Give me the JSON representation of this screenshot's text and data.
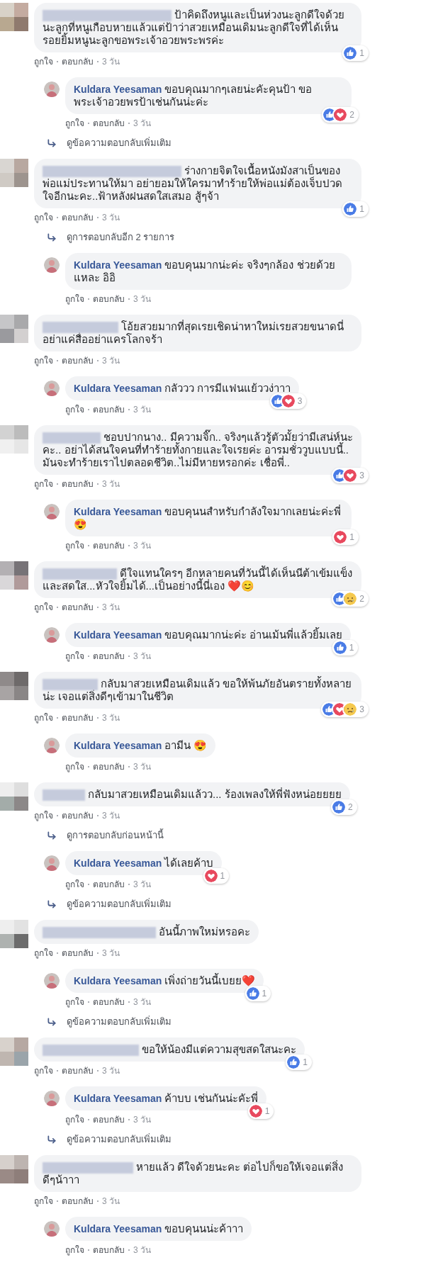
{
  "thread": [
    {
      "kind": "comment",
      "text": "ป้าคิดถึงหนูและเป็นห่วงนะลูกดีใจด้วยนะลูกที่หนูเกือบหายแล้วแต่ป้าว่าสวยเหมือนเดิมนะลูกดีใจที่ได้เห็นรอยยิ้มหนูนะลูกขอพระเจ้าอวยพระพรค่ะ",
      "reactions": [
        {
          "kind": "like"
        }
      ],
      "count": "1",
      "like": "ถูกใจ",
      "reply": "ตอบกลับ",
      "time": "3 วัน"
    },
    {
      "kind": "reply",
      "author": "Kuldara Yeesaman",
      "text": "ขอบคุณมากๆเลยน่ะคัะคุนป้า ขอพระเจ้าอวยพรป้าเช่นกันน่ะค่ะ",
      "reactions": [
        {
          "kind": "like"
        },
        {
          "kind": "love"
        }
      ],
      "count": "2",
      "like": "ถูกใจ",
      "reply": "ตอบกลับ",
      "time": "3 วัน"
    },
    {
      "kind": "more",
      "text": "ดูข้อความตอบกลับเพิ่มเติม"
    },
    {
      "kind": "comment",
      "text": "ร่างกายจิตใจเนื้อหนังมังสาเป็นของพ่อแม่ประทานให้มา อย่ายอมให้ใครมาทำร้ายให้พ่อแม่ต้องเจ็บปวดใจอีกนะคะ..ฟ้าหลังฝนสดใสเสมอ สู้ๆจ้า",
      "reactions": [
        {
          "kind": "like"
        }
      ],
      "count": "1",
      "like": "ถูกใจ",
      "reply": "ตอบกลับ",
      "time": "3 วัน"
    },
    {
      "kind": "more",
      "text": "ดูการตอบกลับอีก 2 รายการ"
    },
    {
      "kind": "reply",
      "author": "Kuldara Yeesaman",
      "text": "ขอบคุนมากน่ะค่ะ จริงๆกล้อง ช่วยด้วยแหละ อิอิ",
      "like": "ถูกใจ",
      "reply": "ตอบกลับ",
      "time": "3 วัน"
    },
    {
      "kind": "comment",
      "text": "โอ้ยสวยมากที่สุดเรยเชิดน่าหาใหม่เรยสวยขนาดนี่อย่าแค่สื่ออย่าแครโลกจร้า",
      "like": "ถูกใจ",
      "reply": "ตอบกลับ",
      "time": "3 วัน"
    },
    {
      "kind": "reply",
      "author": "Kuldara Yeesaman",
      "text": "กลัววว การมีแฟนแย้ววง่าาา",
      "reactions": [
        {
          "kind": "like"
        },
        {
          "kind": "love"
        }
      ],
      "count": "3",
      "like": "ถูกใจ",
      "reply": "ตอบกลับ",
      "time": "3 วัน"
    },
    {
      "kind": "comment",
      "text": "ชอบปากนาง.. มีความจิ๊ก.. จริงๆแล้วรู้ตัวมั้ยว่ามีเสน่ห์นะคะ.. อย่าได้สนใจคนที่ทำร้ายทั้งกายและใจเรยค่ะ อารมชั่ววูบแบบนี้.. มันจะทำร้ายเราไปตลอดชีวิต..ไม่มีหายหรอกค่ะ เชื่อพี่..",
      "reactions": [
        {
          "kind": "like"
        },
        {
          "kind": "love"
        }
      ],
      "count": "3",
      "like": "ถูกใจ",
      "reply": "ตอบกลับ",
      "time": "3 วัน"
    },
    {
      "kind": "reply",
      "author": "Kuldara Yeesaman",
      "text": "ขอบคุนนสำหรับกำลังใจมากเลยน่ะค่ะพี่ 😍",
      "reactions": [
        {
          "kind": "love"
        }
      ],
      "count": "1",
      "like": "ถูกใจ",
      "reply": "ตอบกลับ",
      "time": "3 วัน"
    },
    {
      "kind": "comment",
      "text": "ดีใจแทนใครๆ อีกหลายคนที่วันนี้ได้เห็นนีต้าเข้มแข็งและสดใส...หัวใจยิ้มได้...เป็นอย่างนี้นี่เอง ❤️😊",
      "reactions": [
        {
          "kind": "like"
        },
        {
          "kind": "sad"
        }
      ],
      "count": "2",
      "like": "ถูกใจ",
      "reply": "ตอบกลับ",
      "time": "3 วัน"
    },
    {
      "kind": "reply",
      "author": "Kuldara Yeesaman",
      "text": "ขอบคุณมากน่ะค่ะ อ่านเม้นพี่แล้วยิ้มเลย",
      "reactions": [
        {
          "kind": "like"
        }
      ],
      "count": "1",
      "like": "ถูกใจ",
      "reply": "ตอบกลับ",
      "time": "3 วัน"
    },
    {
      "kind": "comment",
      "text": "กลับมาสวยเหมือนเดิมแล้ว ขอให้พ้นภัยอันตรายทั้งหลายน่ะ เจอแต่สิ่งดีๆเข้ามาในชีวิต",
      "reactions": [
        {
          "kind": "like"
        },
        {
          "kind": "love"
        },
        {
          "kind": "sad"
        }
      ],
      "count": "3",
      "like": "ถูกใจ",
      "reply": "ตอบกลับ",
      "time": "3 วัน"
    },
    {
      "kind": "reply",
      "author": "Kuldara Yeesaman",
      "text": "อามีน 😍",
      "like": "ถูกใจ",
      "reply": "ตอบกลับ",
      "time": "3 วัน"
    },
    {
      "kind": "comment",
      "text": "กลับมาสวยเหมือนเดิมแล้วว... ร้องเพลงให้พี่ฟังหน่อยยยย",
      "reactions": [
        {
          "kind": "like"
        }
      ],
      "count": "2",
      "like": "ถูกใจ",
      "reply": "ตอบกลับ",
      "time": "3 วัน"
    },
    {
      "kind": "more",
      "text": "ดูการตอบกลับก่อนหน้านี้"
    },
    {
      "kind": "reply",
      "author": "Kuldara Yeesaman",
      "text": "ได้เลยค้าบ",
      "reactions": [
        {
          "kind": "love"
        }
      ],
      "count": "1",
      "like": "ถูกใจ",
      "reply": "ตอบกลับ",
      "time": "3 วัน"
    },
    {
      "kind": "more",
      "text": "ดูข้อความตอบกลับเพิ่มเติม"
    },
    {
      "kind": "comment",
      "text": "อันนี้ภาพใหม่หรอคะ",
      "like": "ถูกใจ",
      "reply": "ตอบกลับ",
      "time": "3 วัน"
    },
    {
      "kind": "reply",
      "author": "Kuldara Yeesaman",
      "text": "เพิ่งถ่ายวันนี้เบยย❤️",
      "reactions": [
        {
          "kind": "like"
        }
      ],
      "count": "1",
      "like": "ถูกใจ",
      "reply": "ตอบกลับ",
      "time": "3 วัน"
    },
    {
      "kind": "more",
      "text": "ดูข้อความตอบกลับเพิ่มเติม"
    },
    {
      "kind": "comment",
      "text": "ขอให้น้องมีแต่ความสุขสดใสนะคะ",
      "reactions": [
        {
          "kind": "like"
        }
      ],
      "count": "1",
      "like": "ถูกใจ",
      "reply": "ตอบกลับ",
      "time": "3 วัน"
    },
    {
      "kind": "reply",
      "author": "Kuldara Yeesaman",
      "text": "ค้าบบ เช่นกันน่ะคัะพี่",
      "reactions": [
        {
          "kind": "love"
        }
      ],
      "count": "1",
      "like": "ถูกใจ",
      "reply": "ตอบกลับ",
      "time": "3 วัน"
    },
    {
      "kind": "more",
      "text": "ดูข้อความตอบกลับเพิ่มเติม"
    },
    {
      "kind": "comment",
      "text": "หายแล้ว ดีใจด้วยนะคะ ต่อไปก็ขอให้เจอแต่สิ่งดีๆน้าาา",
      "like": "ถูกใจ",
      "reply": "ตอบกลับ",
      "time": "3 วัน"
    },
    {
      "kind": "reply",
      "author": "Kuldara Yeesaman",
      "text": "ขอบคุนนน่ะค้าาา",
      "like": "ถูกใจ",
      "reply": "ตอบกลับ",
      "time": "3 วัน"
    }
  ]
}
